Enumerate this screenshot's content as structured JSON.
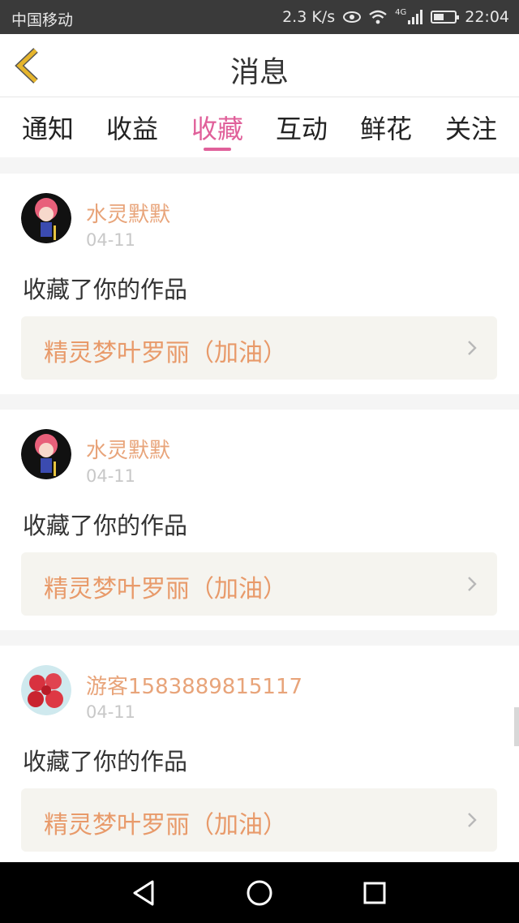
{
  "status_bar": {
    "carrier": "中国移动",
    "speed": "2.3 K/s",
    "network": "4G",
    "time": "22:04"
  },
  "header": {
    "title": "消息"
  },
  "tabs": [
    {
      "label": "通知",
      "active": false
    },
    {
      "label": "收益",
      "active": false
    },
    {
      "label": "收藏",
      "active": true
    },
    {
      "label": "互动",
      "active": false
    },
    {
      "label": "鲜花",
      "active": false
    },
    {
      "label": "关注",
      "active": false
    }
  ],
  "notifications": [
    {
      "username": "水灵默默",
      "date": "04-11",
      "action": "收藏了你的作品",
      "work_title": "精灵梦叶罗丽（加油）",
      "avatar": "doll-avatar"
    },
    {
      "username": "水灵默默",
      "date": "04-11",
      "action": "收藏了你的作品",
      "work_title": "精灵梦叶罗丽（加油）",
      "avatar": "doll-avatar"
    },
    {
      "username": "游客1583889815117",
      "date": "04-11",
      "action": "收藏了你的作品",
      "work_title": "精灵梦叶罗丽（加油）",
      "avatar": "roses-avatar"
    }
  ],
  "colors": {
    "accent": "#e0609a",
    "username": "#e8a47a",
    "work_title": "#e89a6a",
    "back_icon": "#e6b52c"
  }
}
